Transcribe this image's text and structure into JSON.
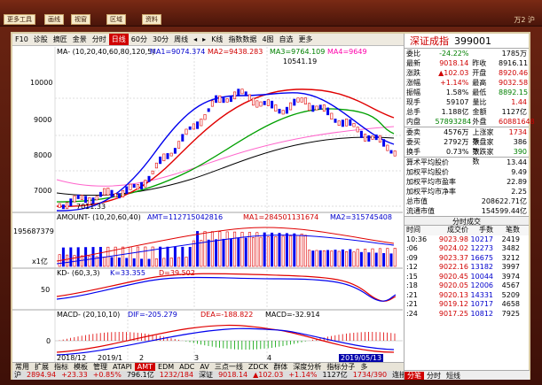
{
  "app": {
    "top_buttons": [
      "更多工具",
      "画线",
      "视窗",
      "",
      "区域",
      "",
      "资料"
    ],
    "top_right": "万2 沪"
  },
  "toolbar": {
    "items": [
      "F10",
      "诊股",
      "摘匠",
      "金景",
      "分时",
      "日线",
      "60分",
      "30分",
      "周线",
      "◂",
      "▸",
      "K线",
      "指数数据",
      "4图",
      "自选",
      "更多"
    ],
    "active": "日线"
  },
  "stock": {
    "name": "深证成指",
    "code": "399001"
  },
  "quote": [
    {
      "l1": "委比",
      "v1": "-24.22%",
      "l2": "",
      "v2": "1785万",
      "c1": "green",
      "c2": "blk"
    },
    {
      "l1": "最新",
      "v1": "9018.14",
      "l2": "昨收",
      "v2": "8916.11",
      "c1": "red",
      "c2": "blk"
    },
    {
      "l1": "涨跌",
      "v1": "▲102.03",
      "l2": "开盘",
      "v2": "8920.46",
      "c1": "red",
      "c2": "red"
    },
    {
      "l1": "涨幅",
      "v1": "+1.14%",
      "l2": "最高",
      "v2": "9032.58",
      "c1": "red",
      "c2": "red"
    },
    {
      "l1": "振幅",
      "v1": "1.58%",
      "l2": "最低",
      "v2": "8892.15",
      "c1": "blk",
      "c2": "green"
    },
    {
      "l1": "现手",
      "v1": "59107",
      "l2": "量比",
      "v2": "1.44",
      "c1": "blk",
      "c2": "red"
    },
    {
      "l1": "总手",
      "v1": "1.188亿",
      "l2": "金额",
      "v2": "1127亿",
      "c1": "blk",
      "c2": "blk"
    },
    {
      "l1": "内盘",
      "v1": "57893284",
      "l2": "外盘",
      "v2": "60881648",
      "c1": "green",
      "c2": "red"
    }
  ],
  "quote2": [
    {
      "l1": "委卖",
      "v1": "4576万",
      "l2": "上涨家数",
      "v2": "1734",
      "c1": "blk",
      "c2": "red"
    },
    {
      "l1": "委买",
      "v1": "2792万",
      "l2": "平盘家数",
      "v2": "386",
      "c1": "blk",
      "c2": "blk"
    },
    {
      "l1": "换手",
      "v1": "0.73%",
      "l2": "下跌家数",
      "v2": "390",
      "c1": "blk",
      "c2": "green"
    }
  ],
  "wide": [
    {
      "label": "算术平均股价",
      "value": "13.44"
    },
    {
      "label": "加权平均股价",
      "value": "9.49"
    },
    {
      "label": "加权平均市盈率",
      "value": "22.89"
    },
    {
      "label": "加权平均市净率",
      "value": "2.25"
    },
    {
      "label": "总市值",
      "value": "208622.71亿"
    },
    {
      "label": "流通市值",
      "value": "154599.44亿"
    }
  ],
  "tape_title": "分时成交",
  "tape_head": [
    "时间",
    "成交价",
    "手数",
    "笔数"
  ],
  "tape": [
    {
      "t": "10:36",
      "p": "9023.98",
      "v": "10217",
      "n": "2419"
    },
    {
      "t": ":06",
      "p": "9024.02",
      "v": "12273",
      "n": "3482"
    },
    {
      "t": ":09",
      "p": "9023.37",
      "v": "16675",
      "n": "3212"
    },
    {
      "t": ":12",
      "p": "9022.16",
      "v": "13182",
      "n": "3997"
    },
    {
      "t": ":15",
      "p": "9020.45",
      "v": "10044",
      "n": "3974"
    },
    {
      "t": ":18",
      "p": "9020.05",
      "v": "12006",
      "n": "4567"
    },
    {
      "t": ":21",
      "p": "9020.13",
      "v": "14331",
      "n": "5209"
    },
    {
      "t": ":21",
      "p": "9019.12",
      "v": "10717",
      "n": "4658"
    },
    {
      "t": ":24",
      "p": "9017.25",
      "v": "10812",
      "n": "7925"
    }
  ],
  "subtabs": [
    "分笔",
    "分时",
    "短线"
  ],
  "subtab_active": "分笔",
  "chart_labels": {
    "ma": "MA- (10,20,40,60,80,120,5)",
    "ma1": "MA1=9074.374",
    "ma2": "MA2=9438.283",
    "ma3": "MA3=9764.109",
    "ma4": "MA4=9649",
    "high": "10541.19",
    "low": "7011.33",
    "amount": "AMOUNT- (10,20,60,40)",
    "amt": "AMT=112715042816",
    "amt_ma1": "MA1=284501131674",
    "amt_ma2": "MA2=315745408",
    "amt_y": "195687379",
    "amt_unit": "x1亿",
    "kd": "KD- (60,3,3)",
    "kd_k": "K=33.355",
    "kd_d": "D=39.502",
    "macd": "MACD- (20,10,10)",
    "dif": "DIF=-205.279",
    "dea": "DEA=-188.822",
    "macd_v": "MACD=-32.914",
    "x1": "2018/12",
    "x2": "2019/1",
    "x3": "2",
    "x4": "3",
    "x5": "4",
    "xend": "2019/05/13",
    "y_top": "10000",
    "y_mid": "9000",
    "y_8k": "8000",
    "y_7k": "7000",
    "kd_y": "50",
    "macd_y": "0"
  },
  "bottom_tabs": [
    "常用",
    "扩展",
    "指标",
    "模板",
    "管理",
    "ATAPI",
    "AMT",
    "EDM",
    "ADC",
    "AV",
    "三点一线",
    "ZDCK",
    "群体",
    "深度分析",
    "",
    "指标分子",
    "多"
  ],
  "bottom_active": "AMT",
  "status": [
    {
      "text": "沪",
      "c": "blk"
    },
    {
      "text": "2894.94",
      "c": "red"
    },
    {
      "text": "+23.33",
      "c": "red"
    },
    {
      "text": "+0.85%",
      "c": "red"
    },
    {
      "text": "796.1亿",
      "c": "blk"
    },
    {
      "text": "1232/184",
      "c": "red"
    },
    {
      "text": "深证",
      "c": "blk"
    },
    {
      "text": "9018.14",
      "c": "red"
    },
    {
      "text": "▲102.03",
      "c": "red"
    },
    {
      "text": "+1.14%",
      "c": "red"
    },
    {
      "text": "1127亿",
      "c": "blk"
    },
    {
      "text": "1734/390",
      "c": "red"
    },
    {
      "text": "连接云服务",
      "c": "blk"
    }
  ]
}
